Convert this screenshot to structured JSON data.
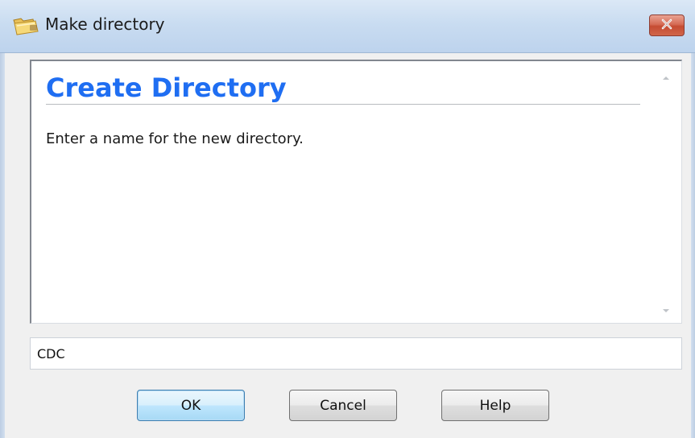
{
  "window": {
    "title": "Make directory",
    "icon": "folder-icon"
  },
  "content": {
    "heading": "Create Directory",
    "instruction": "Enter a name for the new directory."
  },
  "input": {
    "value": "CDC"
  },
  "buttons": {
    "ok": "OK",
    "cancel": "Cancel",
    "help": "Help"
  },
  "colors": {
    "heading": "#1f6ef2",
    "close_button": "#c54c33",
    "titlebar": "#c9dcf1",
    "ok_button_highlight": "#bee6fd"
  }
}
